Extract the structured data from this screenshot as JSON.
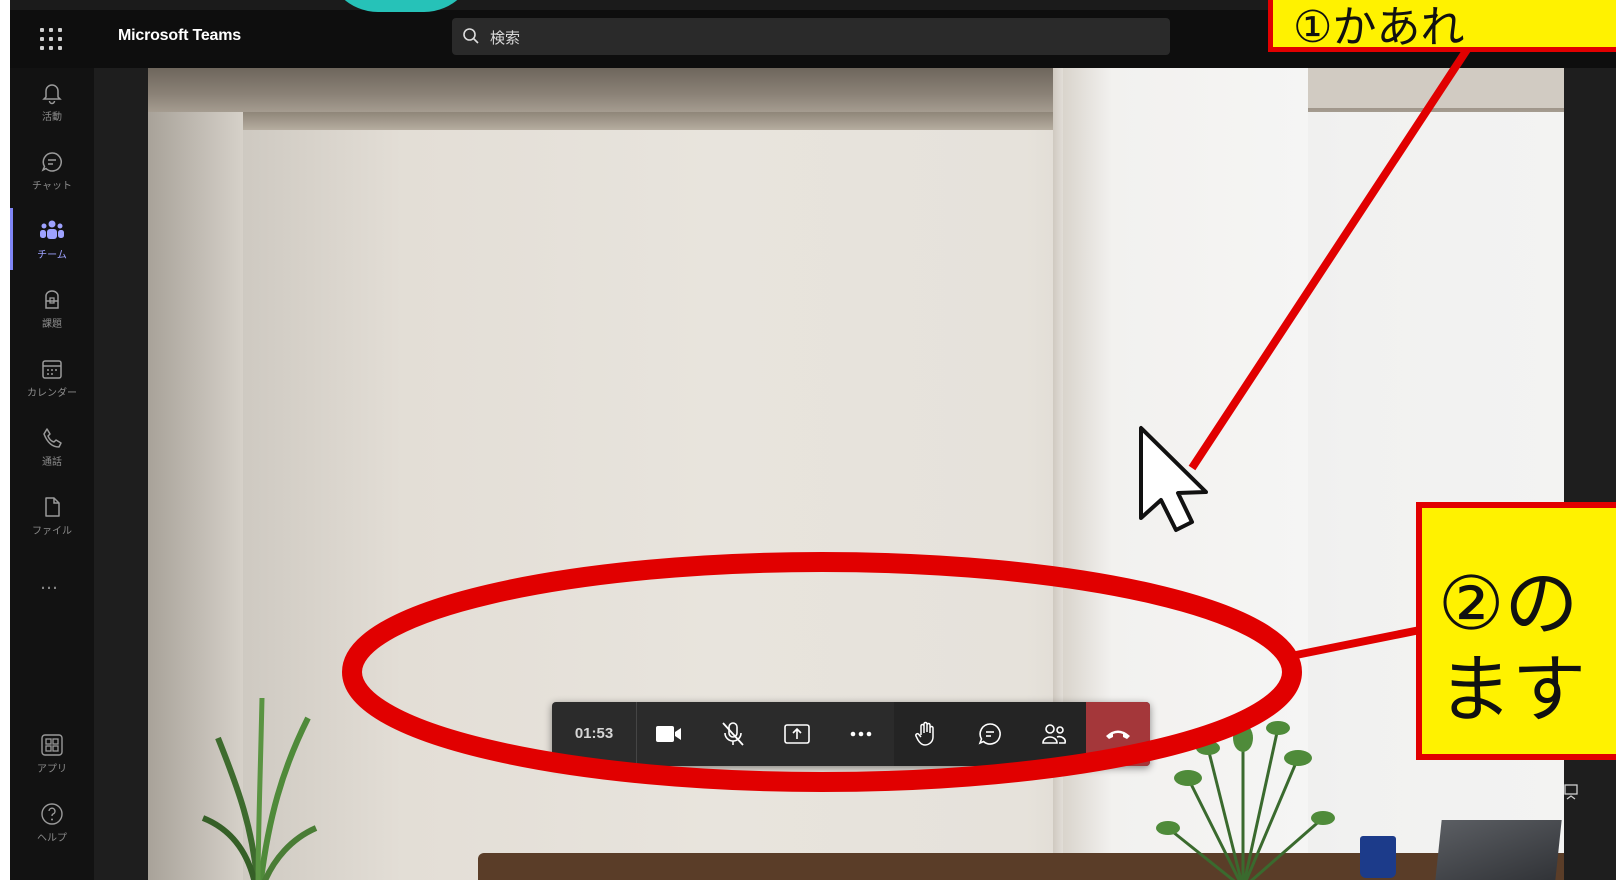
{
  "window": {
    "app_title": "Microsoft Teams"
  },
  "search": {
    "placeholder": "検索",
    "icon": "search-icon"
  },
  "rail": {
    "items": [
      {
        "label": "活動",
        "icon": "bell-icon"
      },
      {
        "label": "チャット",
        "icon": "chat-icon"
      },
      {
        "label": "チーム",
        "icon": "teams-icon",
        "active": true
      },
      {
        "label": "課題",
        "icon": "assignments-icon"
      },
      {
        "label": "カレンダー",
        "icon": "calendar-icon"
      },
      {
        "label": "通話",
        "icon": "phone-icon"
      },
      {
        "label": "ファイル",
        "icon": "file-icon"
      }
    ],
    "more": "…",
    "bottom_items": [
      {
        "label": "アプリ",
        "icon": "apps-icon"
      },
      {
        "label": "ヘルプ",
        "icon": "help-icon"
      }
    ]
  },
  "call_controls": {
    "timer": "01:53",
    "buttons": [
      {
        "name": "camera",
        "icon": "camera-icon"
      },
      {
        "name": "mic",
        "icon": "mic-off-icon"
      },
      {
        "name": "share",
        "icon": "share-icon"
      },
      {
        "name": "more",
        "icon": "more-icon"
      },
      {
        "name": "raise-hand",
        "icon": "hand-icon"
      },
      {
        "name": "chat",
        "icon": "chat-icon"
      },
      {
        "name": "participants",
        "icon": "people-icon"
      },
      {
        "name": "hang-up",
        "icon": "hang-up-icon"
      }
    ],
    "hangup_color": "#a4373a"
  },
  "annotations": {
    "callout1": "①かあれ",
    "callout2_line1": "②の",
    "callout2_line2": "ます",
    "highlight_color": "#fff200",
    "marker_color": "#e10000",
    "accent_cyan": "#26c2b8"
  },
  "colors": {
    "rail_active": "#7f85f5",
    "topbar": "#0e0e0e"
  }
}
